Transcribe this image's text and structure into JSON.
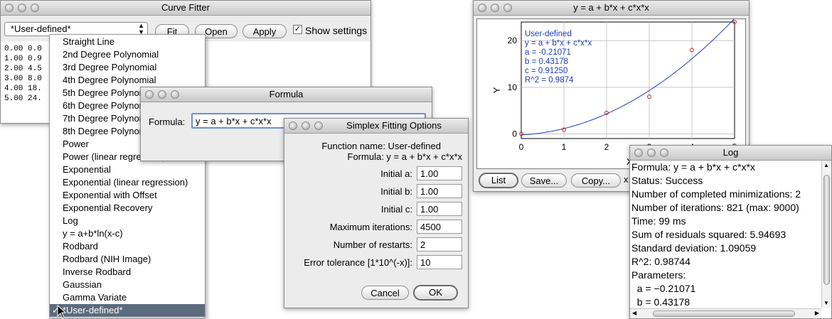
{
  "curve_fitter": {
    "title": "Curve Fitter",
    "function_select": "*User-defined*",
    "fit_label": "Fit",
    "open_label": "Open",
    "apply_label": "Apply",
    "show_settings_label": "Show settings",
    "show_settings_checked": true,
    "data_rows": [
      "0.00  0.0",
      "1.00  0.9",
      "2.00  4.5",
      "3.00  8.0",
      "4.00  18.",
      "5.00  24."
    ]
  },
  "function_menu": {
    "items": [
      "Straight Line",
      "2nd Degree Polynomial",
      "3rd Degree Polynomial",
      "4th Degree Polynomial",
      "5th Degree Polynomial",
      "6th Degree Polynomial",
      "7th Degree Polynomial",
      "8th Degree Polynomial",
      "Power",
      "Power (linear regression)",
      "Exponential",
      "Exponential (linear regression)",
      "Exponential with Offset",
      "Exponential Recovery",
      "Log",
      "y = a+b*ln(x-c)",
      "Rodbard",
      "Rodbard (NIH Image)",
      "Inverse Rodbard",
      "Gaussian",
      "Gamma Variate",
      "*User-defined*"
    ],
    "selected": "*User-defined*"
  },
  "formula_dialog": {
    "title": "Formula",
    "label": "Formula:",
    "value": "y = a + b*x + c*x*x"
  },
  "simplex": {
    "title": "Simplex Fitting Options",
    "function_name_line": "Function name: User-defined",
    "formula_line": "Formula: y = a + b*x + c*x*x",
    "fields": [
      {
        "label": "Initial a:",
        "value": "1.00"
      },
      {
        "label": "Initial b:",
        "value": "1.00"
      },
      {
        "label": "Initial c:",
        "value": "1.00"
      },
      {
        "label": "Maximum iterations:",
        "value": "4500"
      },
      {
        "label": "Number of restarts:",
        "value": "2"
      },
      {
        "label": "Error tolerance [1*10^(-x)]:",
        "value": "10"
      }
    ],
    "cancel_label": "Cancel",
    "ok_label": "OK"
  },
  "plot_window": {
    "title": "y = a + b*x + c*x*x",
    "list_label": "List",
    "save_label": "Save...",
    "copy_label": "Copy...",
    "cut_label": "x"
  },
  "chart_data": {
    "type": "scatter",
    "ylabel": "Y",
    "xlabel": "X",
    "xlim": [
      0,
      5
    ],
    "ylim": [
      -1,
      24
    ],
    "xticks": [
      "0",
      "1",
      "2",
      "3",
      "4",
      "5"
    ],
    "yticks": [
      "0",
      "10",
      "20"
    ],
    "grid": true,
    "points": [
      {
        "x": 0,
        "y": 0.0
      },
      {
        "x": 1,
        "y": 0.9
      },
      {
        "x": 2,
        "y": 4.5
      },
      {
        "x": 3,
        "y": 8.0
      },
      {
        "x": 4,
        "y": 18.0
      },
      {
        "x": 5,
        "y": 24.0
      }
    ],
    "fit": {
      "a": -0.21071,
      "b": 0.43178,
      "c": 0.9125
    },
    "annotation": [
      "User-defined",
      "y = a + b*x + c*x*x",
      "a = -0.21071",
      "b = 0.43178",
      "c = 0.91250",
      "R^2 = 0.9874"
    ],
    "point_color": "#cc2222",
    "curve_color": "#1f3fbf"
  },
  "log": {
    "title": "Log",
    "lines": [
      "Formula: y = a + b*x + c*x*x",
      "Status: Success",
      "Number of completed minimizations: 2",
      "Number of iterations: 821 (max: 9000)",
      "Time: 99 ms",
      "Sum of residuals squared: 5.94693",
      "Standard deviation: 1.09059",
      "R^2: 0.98744",
      "Parameters:",
      "  a = −0.21071",
      "  b = 0.43178"
    ]
  }
}
